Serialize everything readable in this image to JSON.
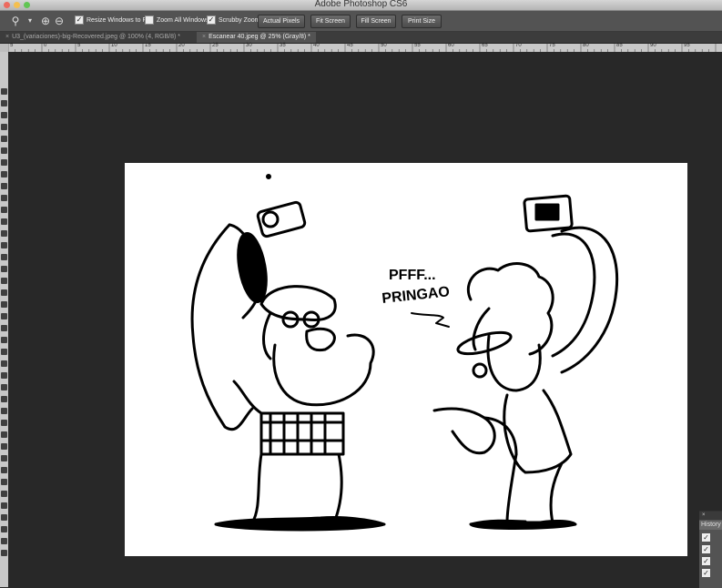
{
  "app": {
    "title": "Adobe Photoshop CS6"
  },
  "options_bar": {
    "zoom_icon": "zoom-tool-icon",
    "resize_windows_to_fit": {
      "label": "Resize Windows to Fit",
      "checked": true
    },
    "zoom_all_windows": {
      "label": "Zoom All Windows",
      "checked": false
    },
    "scrubby_zoom": {
      "label": "Scrubby Zoom",
      "checked": true
    },
    "buttons": {
      "actual_pixels": "Actual Pixels",
      "fit_screen": "Fit Screen",
      "fill_screen": "Fill Screen",
      "print_size": "Print Size"
    }
  },
  "tabs": [
    {
      "label": "U3_(variaciones)-big-Recovered.jpeg @ 100% (4, RGB/8) *",
      "active": false
    },
    {
      "label": "Escanear 40.jpeg @ 25% (Gray/8) *",
      "active": true
    }
  ],
  "ruler": {
    "top_ticks": [
      "5",
      "0",
      "5",
      "10",
      "15",
      "20",
      "25",
      "30",
      "35",
      "40",
      "45",
      "50",
      "55",
      "60",
      "65",
      "70",
      "75",
      "80",
      "85",
      "90",
      "95"
    ]
  },
  "canvas": {
    "speech_text_line1": "PFFF...",
    "speech_text_line2": "PRINGAO"
  },
  "history_panel": {
    "title": "History",
    "close": "×",
    "rows": 4
  }
}
